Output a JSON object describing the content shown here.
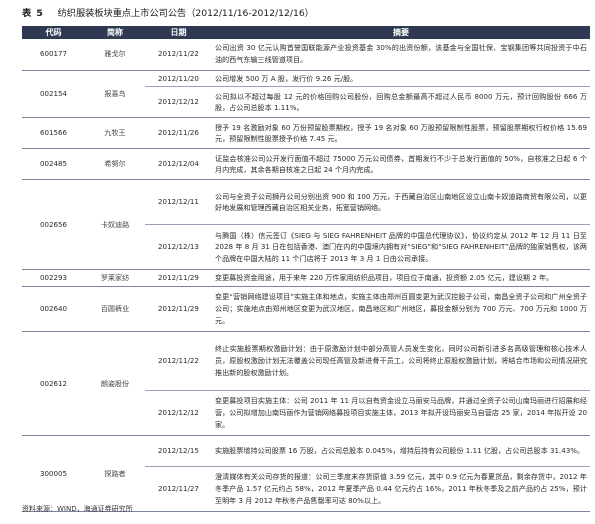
{
  "title": {
    "label": "表 5",
    "text": "纺织服装板块重点上市公司公告（2012/11/16-2012/12/16）"
  },
  "table": {
    "headers": [
      "代码",
      "简称",
      "日期",
      "摘要"
    ],
    "rows": [
      {
        "code": "600177",
        "name": "雅戈尔",
        "date": "2012/11/22",
        "summary": "公司出资 30 亿元认购首誉国联能源产业投资基金 30%的出资份额，该基金与全国社保、宝钢集团等共同投资于中石油的西气东输三线管道项目。",
        "rowspan": 1,
        "groupEnd": true,
        "h": 31
      },
      {
        "code": "002154",
        "name": "报喜鸟",
        "date": "2012/11/20",
        "summary": "公司增发 500 万 A 股，发行价 9.26 元/股。",
        "rowspan": 2,
        "groupEnd": false,
        "h": 16
      },
      {
        "code": "",
        "name": "",
        "date": "2012/12/12",
        "summary": "公司拟以不超过每股 12 元的价格回购公司股份，回购总金额最高不超过人民币 8000 万元，预计回购股份 666 万股，占公司总股本 1.11%。",
        "rowspan": 0,
        "groupEnd": true,
        "h": 31
      },
      {
        "code": "601566",
        "name": "九牧王",
        "date": "2012/11/26",
        "summary": "授予 19 名激励对象 60 万份预留股票期权，授予 19 名对象 60 万股预留限制性股票，预留股票期权行权价格 15.69 元，预留限制性股票授予价格 7.45 元。",
        "rowspan": 1,
        "groupEnd": true,
        "h": 31
      },
      {
        "code": "002485",
        "name": "希努尔",
        "date": "2012/12/04",
        "summary": "证监会核准公司公开发行面值不超过 75000 万元公司债券，首期发行不少于总发行面值的 50%，自核准之日起 6 个月内完成，其余各期自核准之日起 24 个月内完成。",
        "rowspan": 1,
        "groupEnd": true,
        "h": 31
      },
      {
        "code": "002656",
        "name": "卡奴迪路",
        "date": "2012/12/11",
        "summary": "公司与全资子公司狮丹公司分别出资 900 和 100 万元，于西藏自治区山南地区设立山南卡奴迪路商贸有限公司，以更好地发展和管理西藏自治区相关业务，拓宽营销网络。",
        "rowspan": 2,
        "groupEnd": false,
        "h": 45
      },
      {
        "code": "",
        "name": "",
        "date": "2012/12/13",
        "summary": "与腾国（株）信元签订《SIEG 与 SIEG FAHRENHEIT 品牌的中国总代理协议》，协议约定从 2012 年 12 月 11 日至 2028 年 8 月 31 日在包括香港、澳门在内的中国境内拥有对“SIEG”和“SIEG FAHRENHEIT”品牌的独家销售权，该两个品牌在中国大陆的 11 个门店将于 2013 年 3 月 1 日由公司承接。",
        "rowspan": 0,
        "groupEnd": true,
        "h": 45
      },
      {
        "code": "002293",
        "name": "罗莱家纺",
        "date": "2012/11/29",
        "summary": "变更募投资金用途，用于来年 220 万件家用纺织品项目，项目位于南通，投资额 2.05 亿元，建设期 2 年。",
        "rowspan": 1,
        "groupEnd": true,
        "h": 16
      },
      {
        "code": "002640",
        "name": "百圆裤业",
        "date": "2012/11/29",
        "summary": "变更“营销网络建设项目”实施主体和地点，实施主体由郑州百圆变更为武汉控股子公司，南昌全资子公司和广州全资子公司；实施地点由郑州地区变更为武汉地区，南昌地区和广州地区，募投金额分别为 700 万元、700 万元和 1000 万元。",
        "rowspan": 1,
        "groupEnd": true,
        "h": 45
      },
      {
        "code": "002612",
        "name": "朗姿股份",
        "date": "2012/11/22",
        "summary": "终止实施股票期权激励计划：由于原激励计划中部分高管人员发生变化，同时公司新引进多名高级管理和核心技术人员，原股权激励计划无法覆盖公司现任高管及新进骨干员工，公司将终止原股权激励计划，将结合市场和公司情况研究推出新的股权激励计划。",
        "rowspan": 2,
        "groupEnd": false,
        "h": 59
      },
      {
        "code": "",
        "name": "",
        "date": "2012/12/12",
        "summary": "变更募投项目实施主体：公司 2011 年 11 月以自有资金设立马丽安马品牌，并通过全资子公司山南玛丽进行招展和经营，公司拟增加山南玛丽作为营销网络募投项目实施主体，2013 年拟开设玛丽安马自营店 25 家，2014 年拟开设 20 家。",
        "rowspan": 0,
        "groupEnd": true,
        "h": 45
      },
      {
        "code": "300005",
        "name": "探路者",
        "date": "2012/12/15",
        "summary": "实施股票增持公司股票 16 万股，占公司总股本 0.045%，增持后持有公司股份 1.11 亿股，占公司总股本 31.43%。",
        "rowspan": 2,
        "groupEnd": false,
        "h": 31
      },
      {
        "code": "",
        "name": "",
        "date": "2012/11/27",
        "summary": "澄清媒体有关公司存货的报道：公司三季度末存货原值 3.59 亿元，其中 0.9 亿元为春夏货品，剩余存货中，2012 年冬季产品 1.57 亿元约占 58%，2012 年夏季产品 0.44 亿元约占 16%，2011 年秋冬季及之前产品约占 25%，预计至明年 3 月 2012 年秋冬产品售罄率可达 80%以上。",
        "rowspan": 0,
        "groupEnd": true,
        "h": 45
      }
    ]
  },
  "source": "资料来源：WIND，海通证券研究所"
}
